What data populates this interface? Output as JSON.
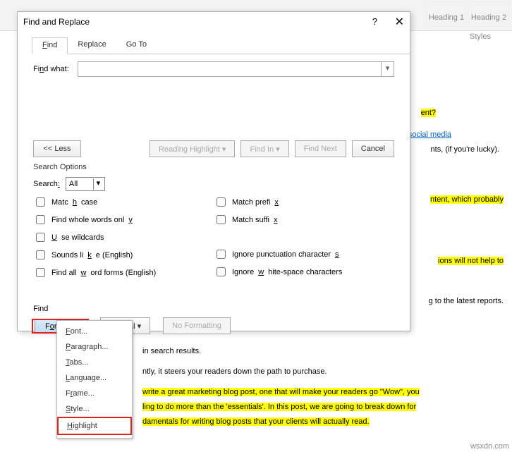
{
  "ribbon": {
    "heading1": "Heading 1",
    "heading2": "Heading 2",
    "styles": "Styles"
  },
  "dialog": {
    "title": "Find and Replace",
    "help": "?",
    "close": "✕",
    "tabs": {
      "find": "Find",
      "replace": "Replace",
      "goto": "Go To"
    },
    "findwhat": "Find what:",
    "buttons": {
      "less": "<< Less",
      "reading": "Reading Highlight ▾",
      "findin": "Find In ▾",
      "findnext": "Find Next",
      "cancel": "Cancel"
    },
    "search_options": "Search Options",
    "search_label": "Search:",
    "search_dd": "All",
    "opts": {
      "matchcase": "Match case",
      "whole": "Find whole words only",
      "wild": "Use wildcards",
      "sounds": "Sounds like (English)",
      "allforms": "Find all word forms (English)",
      "prefix": "Match prefix",
      "suffix": "Match suffix",
      "punct": "Ignore punctuation characters",
      "white": "Ignore white-space characters"
    },
    "find_label": "Find",
    "format": "Format ▾",
    "special": "Special ▾",
    "noformat": "No Formatting"
  },
  "menu": {
    "font": "Font...",
    "paragraph": "Paragraph...",
    "tabs": "Tabs...",
    "language": "Language...",
    "frame": "Frame...",
    "style": "Style...",
    "highlight": "Highlight"
  },
  "doc": {
    "l1": "ent?",
    "l2": "social media",
    "l3": "nts, (if you're lucky).",
    "l4": "ntent, which probably",
    "l5": "ions will not help to",
    "l6": "g to the latest reports.",
    "l7": "in search results.",
    "l8": "ntly, it steers your readers down the path to purchase.",
    "l9": " write a great marketing blog post, one that will make your readers go \"Wow\", you",
    "l10": "ling to do more than the 'essentials'. In this post, we are going to break down for",
    "l11": "damentals for writing blog posts that your clients will actually read."
  },
  "source": "wsxdn.com"
}
